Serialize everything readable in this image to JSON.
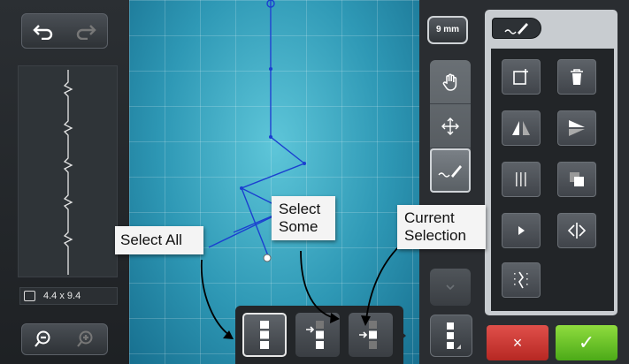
{
  "toolbar": {
    "undo_icon": "undo-arrow-icon",
    "redo_icon": "redo-arrow-icon",
    "zoom_out_icon": "zoom-out-icon",
    "zoom_in_icon": "zoom-in-icon"
  },
  "preview": {
    "size": "4.4 x 9.4"
  },
  "stitch_length_button": {
    "label": "9 mm"
  },
  "canvas_tools": [
    "hand-pan-icon",
    "move-arrows-icon",
    "stitch-draw-icon"
  ],
  "tool_panel": {
    "tab_icon": "stitch-draw-icon",
    "buttons": [
      "add-point-icon",
      "delete-icon",
      "mirror-horizontal-icon",
      "mirror-vertical-icon",
      "grid-dots-icon",
      "duplicate-icon",
      "play-arrow-icon",
      "flip-direction-icon",
      "split-path-icon"
    ]
  },
  "actions": {
    "cancel": "×",
    "confirm": "✓"
  },
  "selection_bar": {
    "options": [
      "select-all-icon",
      "select-some-icon",
      "current-selection-icon"
    ]
  },
  "annotations": {
    "select_all": "Select All",
    "select_some_line1": "Select",
    "select_some_line2": "Some",
    "current_selection_line1": "Current",
    "current_selection_line2": "Selection"
  },
  "colors": {
    "canvas_center": "#5ec6d9",
    "canvas_edge": "#176f8f",
    "stitch_line": "#1b3fd0",
    "cancel": "#c9332d",
    "confirm": "#63be26"
  }
}
